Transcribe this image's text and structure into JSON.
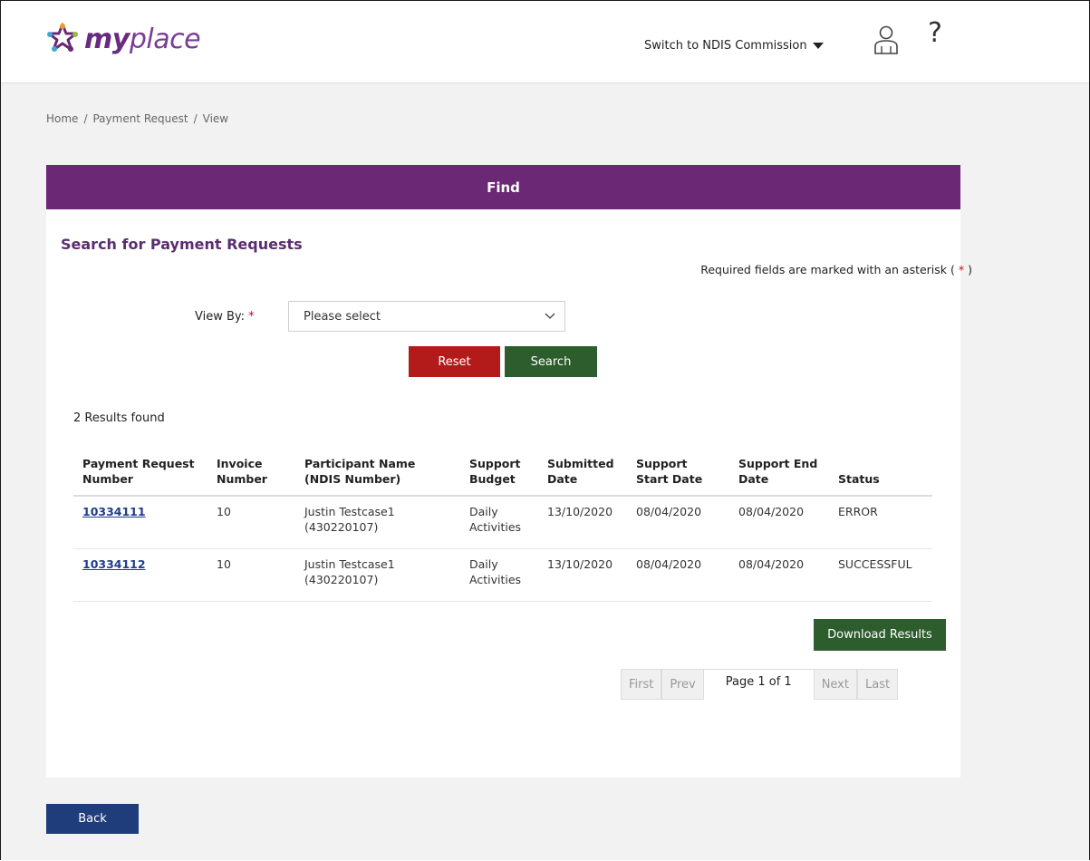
{
  "header": {
    "logo_text_bold": "my",
    "logo_text_light": "place",
    "switch_label": "Switch to NDIS Commission",
    "help_symbol": "?"
  },
  "breadcrumb": {
    "items": [
      "Home",
      "Payment Request",
      "View"
    ],
    "separator": "/"
  },
  "panel": {
    "title": "Find",
    "section_title": "Search for Payment Requests",
    "required_note_prefix": "Required fields are marked with an asterisk (",
    "required_note_star": "*",
    "required_note_suffix": ")",
    "view_by_label": "View By:",
    "required_star": "*",
    "view_by_value": "Please select",
    "reset_label": "Reset",
    "search_label": "Search",
    "results_count": "2 Results found",
    "download_label": "Download Results"
  },
  "table": {
    "headers": {
      "payment_request_number": "Payment Request Number",
      "invoice_number": "Invoice Number",
      "participant_name": "Participant Name (NDIS Number)",
      "support_budget": "Support Budget",
      "submitted_date": "Submitted Date",
      "support_start_date": "Support Start Date",
      "support_end_date": "Support End Date",
      "status": "Status"
    },
    "rows": [
      {
        "payment_request_number": "10334111",
        "invoice_number": "10",
        "participant_name": "Justin Testcase1 (430220107)",
        "support_budget": "Daily Activities",
        "submitted_date": "13/10/2020",
        "support_start_date": "08/04/2020",
        "support_end_date": "08/04/2020",
        "status": "ERROR"
      },
      {
        "payment_request_number": "10334112",
        "invoice_number": "10",
        "participant_name": "Justin Testcase1 (430220107)",
        "support_budget": "Daily Activities",
        "submitted_date": "13/10/2020",
        "support_start_date": "08/04/2020",
        "support_end_date": "08/04/2020",
        "status": "SUCCESSFUL"
      }
    ]
  },
  "pager": {
    "first": "First",
    "prev": "Prev",
    "page_info": "Page 1 of 1",
    "next": "Next",
    "last": "Last"
  },
  "footer": {
    "back_label": "Back"
  },
  "colors": {
    "header_purple": "#6b2874",
    "reset_red": "#b31b1b",
    "action_green": "#2d5d2d",
    "back_navy": "#1f3d7a",
    "link_blue": "#1f3d8a"
  }
}
